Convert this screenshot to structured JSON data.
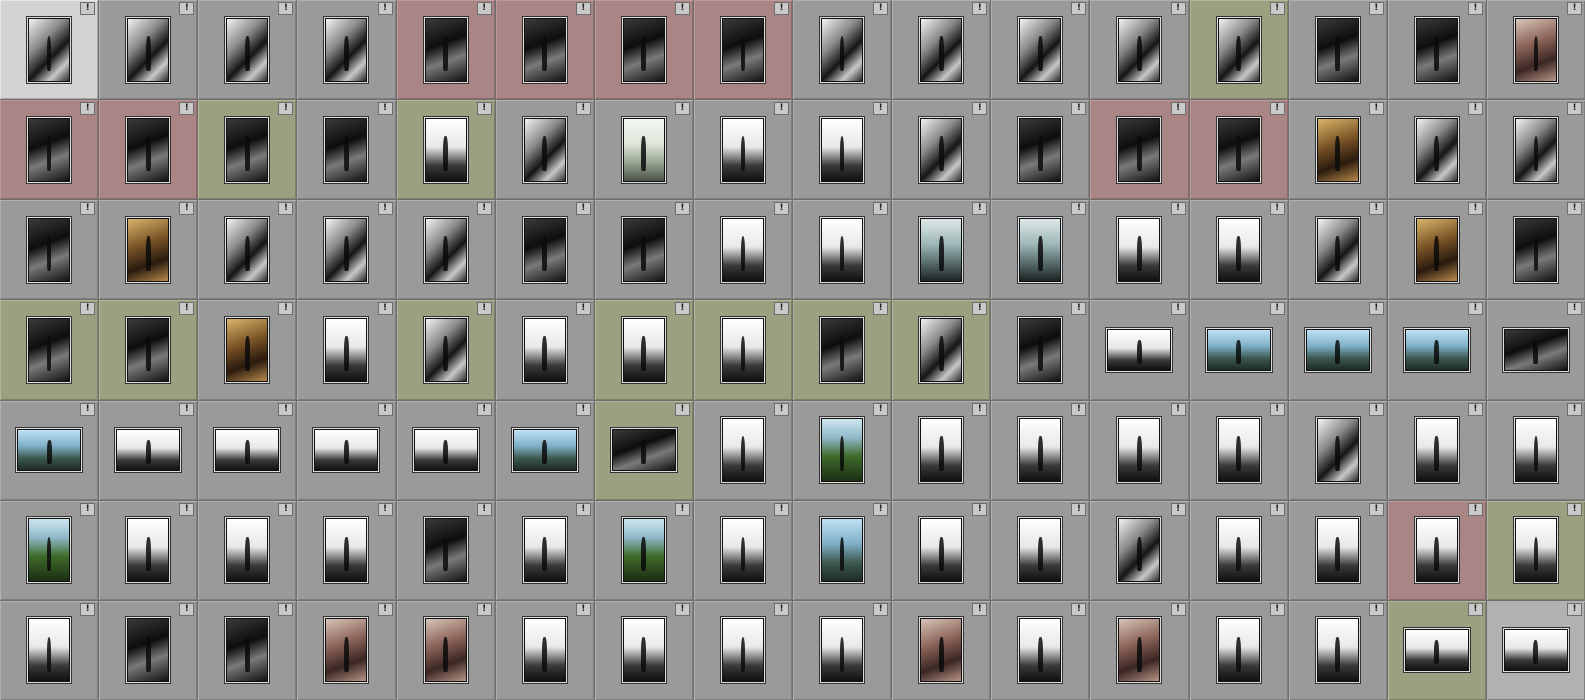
{
  "grid": {
    "badge_label": "!",
    "rows": [
      [
        {
          "s": "selected",
          "o": "p",
          "c": "bw"
        },
        {
          "s": "",
          "o": "p",
          "c": "bw"
        },
        {
          "s": "",
          "o": "p",
          "c": "bw"
        },
        {
          "s": "",
          "o": "p",
          "c": "bw"
        },
        {
          "s": "red",
          "o": "p",
          "c": "dark"
        },
        {
          "s": "red",
          "o": "p",
          "c": "dark"
        },
        {
          "s": "red",
          "o": "p",
          "c": "dark"
        },
        {
          "s": "red",
          "o": "p",
          "c": "dark"
        },
        {
          "s": "",
          "o": "p",
          "c": "bw"
        },
        {
          "s": "",
          "o": "p",
          "c": "bw"
        },
        {
          "s": "",
          "o": "p",
          "c": "bw"
        },
        {
          "s": "",
          "o": "p",
          "c": "bw"
        },
        {
          "s": "olive",
          "o": "p",
          "c": "bw"
        },
        {
          "s": "",
          "o": "p",
          "c": "dark"
        },
        {
          "s": "",
          "o": "p",
          "c": "dark"
        },
        {
          "s": "",
          "o": "p",
          "c": "rose"
        }
      ],
      [
        {
          "s": "red",
          "o": "p",
          "c": "dark"
        },
        {
          "s": "red",
          "o": "p",
          "c": "dark"
        },
        {
          "s": "olive",
          "o": "p",
          "c": "dark"
        },
        {
          "s": "",
          "o": "p",
          "c": "dark"
        },
        {
          "s": "olive",
          "o": "p",
          "c": "light"
        },
        {
          "s": "",
          "o": "p",
          "c": "bw"
        },
        {
          "s": "",
          "o": "p",
          "c": "pale"
        },
        {
          "s": "",
          "o": "p",
          "c": "light"
        },
        {
          "s": "",
          "o": "p",
          "c": "light"
        },
        {
          "s": "",
          "o": "p",
          "c": "bw"
        },
        {
          "s": "",
          "o": "p",
          "c": "dark"
        },
        {
          "s": "red",
          "o": "p",
          "c": "dark"
        },
        {
          "s": "red",
          "o": "p",
          "c": "dark"
        },
        {
          "s": "",
          "o": "p",
          "c": "warm"
        },
        {
          "s": "",
          "o": "p",
          "c": "bw"
        },
        {
          "s": "",
          "o": "p",
          "c": "bw"
        }
      ],
      [
        {
          "s": "",
          "o": "p",
          "c": "dark"
        },
        {
          "s": "",
          "o": "p",
          "c": "warm"
        },
        {
          "s": "",
          "o": "p",
          "c": "bw"
        },
        {
          "s": "",
          "o": "p",
          "c": "bw"
        },
        {
          "s": "",
          "o": "p",
          "c": "bw"
        },
        {
          "s": "",
          "o": "p",
          "c": "dark"
        },
        {
          "s": "",
          "o": "p",
          "c": "dark"
        },
        {
          "s": "",
          "o": "p",
          "c": "light"
        },
        {
          "s": "",
          "o": "p",
          "c": "light"
        },
        {
          "s": "",
          "o": "p",
          "c": "teal"
        },
        {
          "s": "",
          "o": "p",
          "c": "teal"
        },
        {
          "s": "",
          "o": "p",
          "c": "light"
        },
        {
          "s": "",
          "o": "p",
          "c": "light"
        },
        {
          "s": "",
          "o": "p",
          "c": "bw"
        },
        {
          "s": "",
          "o": "p",
          "c": "warm"
        },
        {
          "s": "",
          "o": "p",
          "c": "dark"
        }
      ],
      [
        {
          "s": "olive",
          "o": "p",
          "c": "dark"
        },
        {
          "s": "olive",
          "o": "p",
          "c": "dark"
        },
        {
          "s": "",
          "o": "p",
          "c": "warm"
        },
        {
          "s": "",
          "o": "p",
          "c": "light"
        },
        {
          "s": "olive",
          "o": "p",
          "c": "bw"
        },
        {
          "s": "",
          "o": "p",
          "c": "light"
        },
        {
          "s": "olive",
          "o": "p",
          "c": "light"
        },
        {
          "s": "olive",
          "o": "p",
          "c": "light"
        },
        {
          "s": "olive",
          "o": "p",
          "c": "dark"
        },
        {
          "s": "olive",
          "o": "p",
          "c": "bw"
        },
        {
          "s": "",
          "o": "p",
          "c": "dark"
        },
        {
          "s": "",
          "o": "l",
          "c": "light"
        },
        {
          "s": "",
          "o": "l",
          "c": "blue"
        },
        {
          "s": "",
          "o": "l",
          "c": "blue"
        },
        {
          "s": "",
          "o": "l",
          "c": "blue"
        },
        {
          "s": "",
          "o": "l",
          "c": "dark"
        }
      ],
      [
        {
          "s": "",
          "o": "l",
          "c": "blue"
        },
        {
          "s": "",
          "o": "l",
          "c": "light"
        },
        {
          "s": "",
          "o": "l",
          "c": "light"
        },
        {
          "s": "",
          "o": "l",
          "c": "light"
        },
        {
          "s": "",
          "o": "l",
          "c": "light"
        },
        {
          "s": "",
          "o": "l",
          "c": "blue"
        },
        {
          "s": "olive",
          "o": "l",
          "c": "dark"
        },
        {
          "s": "",
          "o": "p",
          "c": "light"
        },
        {
          "s": "",
          "o": "p",
          "c": "green"
        },
        {
          "s": "",
          "o": "p",
          "c": "light"
        },
        {
          "s": "",
          "o": "p",
          "c": "light"
        },
        {
          "s": "",
          "o": "p",
          "c": "light"
        },
        {
          "s": "",
          "o": "p",
          "c": "light"
        },
        {
          "s": "",
          "o": "p",
          "c": "bw"
        },
        {
          "s": "",
          "o": "p",
          "c": "light"
        },
        {
          "s": "",
          "o": "p",
          "c": "light"
        }
      ],
      [
        {
          "s": "",
          "o": "p",
          "c": "green"
        },
        {
          "s": "",
          "o": "p",
          "c": "light"
        },
        {
          "s": "",
          "o": "p",
          "c": "light"
        },
        {
          "s": "",
          "o": "p",
          "c": "light"
        },
        {
          "s": "",
          "o": "p",
          "c": "dark"
        },
        {
          "s": "",
          "o": "p",
          "c": "light"
        },
        {
          "s": "",
          "o": "p",
          "c": "green"
        },
        {
          "s": "",
          "o": "p",
          "c": "light"
        },
        {
          "s": "",
          "o": "p",
          "c": "blue"
        },
        {
          "s": "",
          "o": "p",
          "c": "light"
        },
        {
          "s": "",
          "o": "p",
          "c": "light"
        },
        {
          "s": "",
          "o": "p",
          "c": "bw"
        },
        {
          "s": "",
          "o": "p",
          "c": "light"
        },
        {
          "s": "",
          "o": "p",
          "c": "light"
        },
        {
          "s": "red",
          "o": "p",
          "c": "light"
        },
        {
          "s": "olive",
          "o": "p",
          "c": "light"
        }
      ],
      [
        {
          "s": "",
          "o": "p",
          "c": "light"
        },
        {
          "s": "",
          "o": "p",
          "c": "dark"
        },
        {
          "s": "",
          "o": "p",
          "c": "dark"
        },
        {
          "s": "",
          "o": "p",
          "c": "rose"
        },
        {
          "s": "",
          "o": "p",
          "c": "rose"
        },
        {
          "s": "",
          "o": "p",
          "c": "light"
        },
        {
          "s": "",
          "o": "p",
          "c": "light"
        },
        {
          "s": "",
          "o": "p",
          "c": "light"
        },
        {
          "s": "",
          "o": "p",
          "c": "light"
        },
        {
          "s": "",
          "o": "p",
          "c": "rose"
        },
        {
          "s": "",
          "o": "p",
          "c": "light"
        },
        {
          "s": "",
          "o": "p",
          "c": "rose"
        },
        {
          "s": "",
          "o": "p",
          "c": "light"
        },
        {
          "s": "",
          "o": "p",
          "c": "light"
        },
        {
          "s": "olive",
          "o": "l",
          "c": "light"
        },
        {
          "s": "light",
          "o": "l",
          "c": "light"
        }
      ]
    ]
  }
}
